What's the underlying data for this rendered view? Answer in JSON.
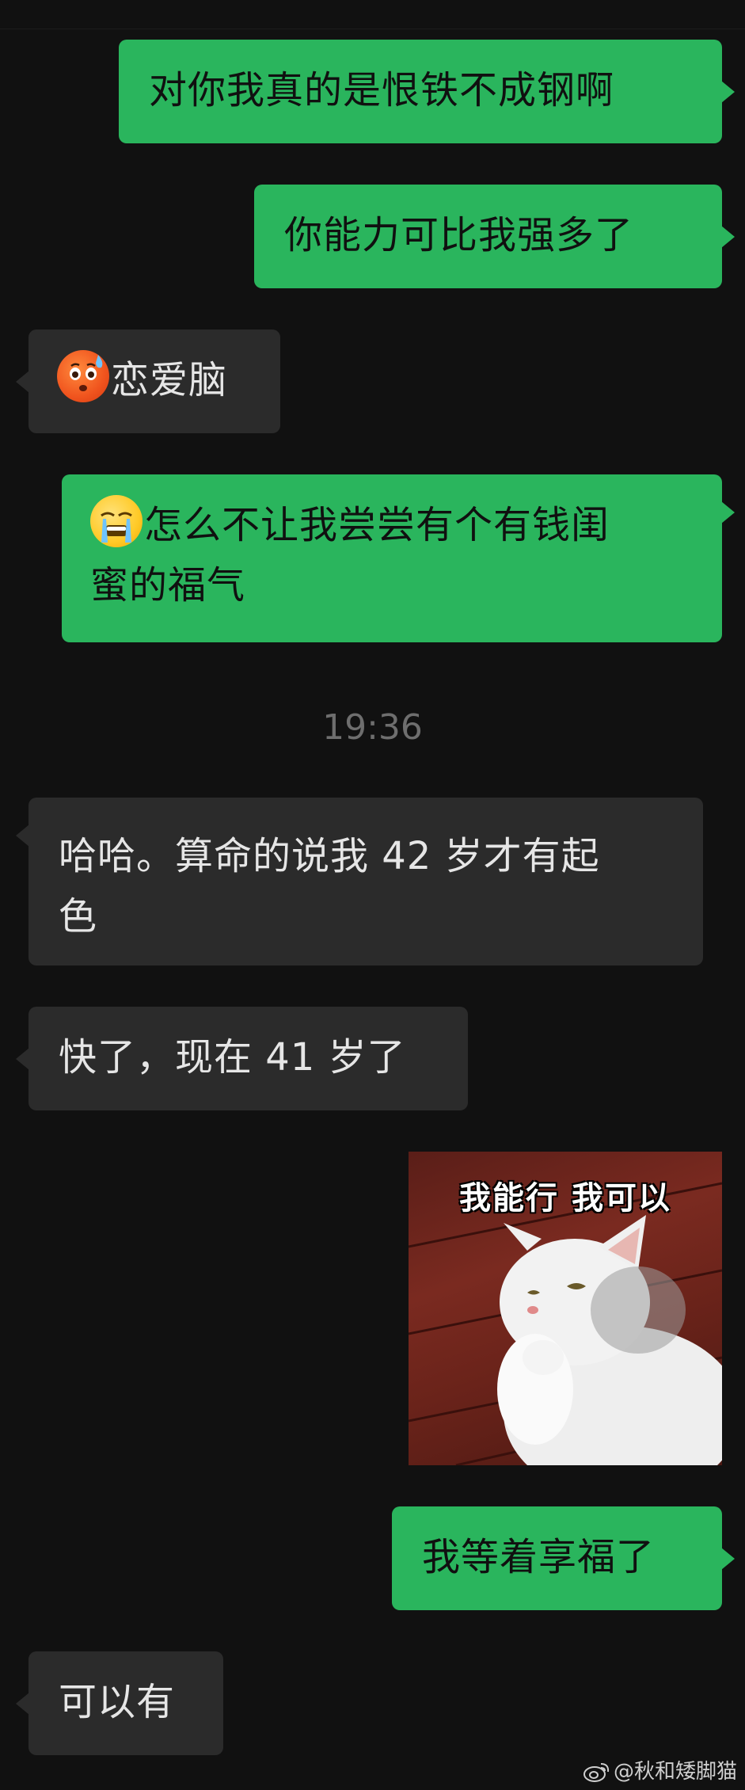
{
  "messages": [
    {
      "side": "sent",
      "text": "对你我真的是恨铁不成钢啊"
    },
    {
      "side": "sent",
      "text": "你能力可比我强多了"
    },
    {
      "side": "recv",
      "emoji": "flushed-sweat-emoji",
      "text": "恋爱脑"
    },
    {
      "side": "sent",
      "emoji": "crying-emoji",
      "text_line1": "怎么不让我尝尝有个有钱闺",
      "text_line2": "蜜的福气"
    },
    {
      "side": "recv",
      "text_line1": "哈哈。算命的说我 42 岁才有起",
      "text_line2": "色"
    },
    {
      "side": "recv",
      "text": "快了，现在 41 岁了"
    },
    {
      "side": "sent",
      "type": "sticker",
      "caption": "我能行 我可以",
      "icon": "cat-sticker"
    },
    {
      "side": "sent",
      "text": "我等着享福了"
    },
    {
      "side": "recv",
      "text": "可以有"
    }
  ],
  "timestamp": "19:36",
  "watermark": {
    "icon": "weibo-icon",
    "text": "@秋和矮脚猫"
  },
  "colors": {
    "background": "#111111",
    "sent_bubble": "#2ab55d",
    "recv_bubble": "#2b2b2b",
    "timestamp": "#6e6e6e"
  }
}
